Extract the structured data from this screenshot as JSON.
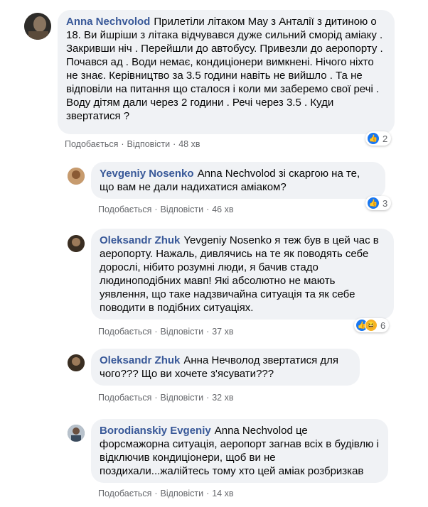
{
  "comments": [
    {
      "author": "Anna Nechvolod",
      "text": "Прилетіли літаком Мау з Анталії з дитиною о 18. Ви йшріши з літака відчувався дуже сильний сморід аміаку . Закривши ніч . Перейшли до автобусу. Привезли до аеропорту . Почався ад . Води немає, кондиціонери вимкнені. Нічого ніхто не знає. Керівництво за 3.5 години навіть не вийшло . Та не відповіли на питання що сталося і коли ми заберемо свої речі . Воду дітям дали через 2 години . Речі через 3.5 . Куди звертатися ?",
      "like_label": "Подобається",
      "reply_label": "Відповісти",
      "time": "48 хв",
      "reactions": "2",
      "avatar_color": "#3c3a36"
    },
    {
      "author": "Yevgeniy Nosenko",
      "text": "Anna Nechvolod зі скаргою на те, що вам не дали надихатися аміаком?",
      "like_label": "Подобається",
      "reply_label": "Відповісти",
      "time": "46 хв",
      "reactions": "3",
      "avatar_color": "#a06a3e"
    },
    {
      "author": "Oleksandr Zhuk",
      "text": "Yevgeniy Nosenko я теж був в цей час в аеропорту. Нажаль, дивлячись на те як поводять себе дорослі, нібито розумні люди, я бачив стадо людиноподібних мавп! Які абсолютно не мають уявлення, що таке надзвичайна ситуація та як себе поводити в подібних ситуаціях.",
      "like_label": "Подобається",
      "reply_label": "Відповісти",
      "time": "37 хв",
      "reactions": "6",
      "avatar_color": "#4a3b2c"
    },
    {
      "author": "Oleksandr Zhuk",
      "text": "Анна Нечволод звертатися для чого??? Що ви хочете з'ясувати???",
      "like_label": "Подобається",
      "reply_label": "Відповісти",
      "time": "32 хв",
      "reactions": "",
      "avatar_color": "#4a3b2c"
    },
    {
      "author": "Borodianskiy Evgeniy",
      "text": "Anna Nechvolod це форсмажорна ситуація, аеропорт загнав всіх в будівлю і відключив кондиціонери, щоб ви не поздихали...жалійтесь тому хто цей аміак розбризкав",
      "like_label": "Подобається",
      "reply_label": "Відповісти",
      "time": "14 хв",
      "reactions": "",
      "avatar_color": "#5a6b7d"
    }
  ],
  "colors": {
    "author": "#385898",
    "bubble": "#f0f2f5",
    "meta": "#65676b",
    "like": "#1877f2"
  }
}
